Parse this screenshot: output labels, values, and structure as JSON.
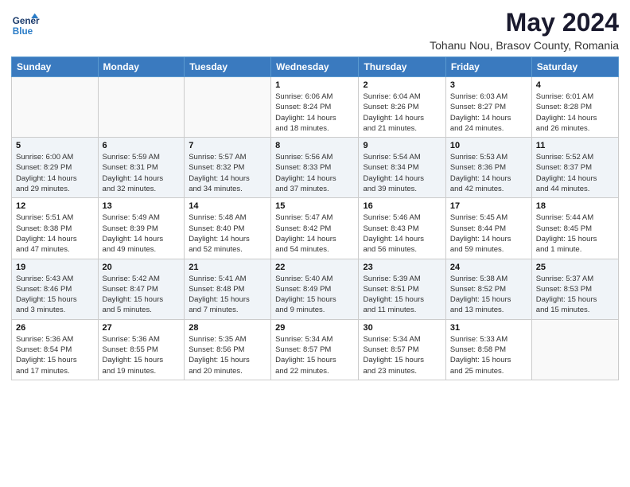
{
  "logo": {
    "line1": "General",
    "line2": "Blue"
  },
  "title": "May 2024",
  "subtitle": "Tohanu Nou, Brasov County, Romania",
  "days_header": [
    "Sunday",
    "Monday",
    "Tuesday",
    "Wednesday",
    "Thursday",
    "Friday",
    "Saturday"
  ],
  "weeks": [
    [
      {
        "day": "",
        "info": ""
      },
      {
        "day": "",
        "info": ""
      },
      {
        "day": "",
        "info": ""
      },
      {
        "day": "1",
        "info": "Sunrise: 6:06 AM\nSunset: 8:24 PM\nDaylight: 14 hours\nand 18 minutes."
      },
      {
        "day": "2",
        "info": "Sunrise: 6:04 AM\nSunset: 8:26 PM\nDaylight: 14 hours\nand 21 minutes."
      },
      {
        "day": "3",
        "info": "Sunrise: 6:03 AM\nSunset: 8:27 PM\nDaylight: 14 hours\nand 24 minutes."
      },
      {
        "day": "4",
        "info": "Sunrise: 6:01 AM\nSunset: 8:28 PM\nDaylight: 14 hours\nand 26 minutes."
      }
    ],
    [
      {
        "day": "5",
        "info": "Sunrise: 6:00 AM\nSunset: 8:29 PM\nDaylight: 14 hours\nand 29 minutes."
      },
      {
        "day": "6",
        "info": "Sunrise: 5:59 AM\nSunset: 8:31 PM\nDaylight: 14 hours\nand 32 minutes."
      },
      {
        "day": "7",
        "info": "Sunrise: 5:57 AM\nSunset: 8:32 PM\nDaylight: 14 hours\nand 34 minutes."
      },
      {
        "day": "8",
        "info": "Sunrise: 5:56 AM\nSunset: 8:33 PM\nDaylight: 14 hours\nand 37 minutes."
      },
      {
        "day": "9",
        "info": "Sunrise: 5:54 AM\nSunset: 8:34 PM\nDaylight: 14 hours\nand 39 minutes."
      },
      {
        "day": "10",
        "info": "Sunrise: 5:53 AM\nSunset: 8:36 PM\nDaylight: 14 hours\nand 42 minutes."
      },
      {
        "day": "11",
        "info": "Sunrise: 5:52 AM\nSunset: 8:37 PM\nDaylight: 14 hours\nand 44 minutes."
      }
    ],
    [
      {
        "day": "12",
        "info": "Sunrise: 5:51 AM\nSunset: 8:38 PM\nDaylight: 14 hours\nand 47 minutes."
      },
      {
        "day": "13",
        "info": "Sunrise: 5:49 AM\nSunset: 8:39 PM\nDaylight: 14 hours\nand 49 minutes."
      },
      {
        "day": "14",
        "info": "Sunrise: 5:48 AM\nSunset: 8:40 PM\nDaylight: 14 hours\nand 52 minutes."
      },
      {
        "day": "15",
        "info": "Sunrise: 5:47 AM\nSunset: 8:42 PM\nDaylight: 14 hours\nand 54 minutes."
      },
      {
        "day": "16",
        "info": "Sunrise: 5:46 AM\nSunset: 8:43 PM\nDaylight: 14 hours\nand 56 minutes."
      },
      {
        "day": "17",
        "info": "Sunrise: 5:45 AM\nSunset: 8:44 PM\nDaylight: 14 hours\nand 59 minutes."
      },
      {
        "day": "18",
        "info": "Sunrise: 5:44 AM\nSunset: 8:45 PM\nDaylight: 15 hours\nand 1 minute."
      }
    ],
    [
      {
        "day": "19",
        "info": "Sunrise: 5:43 AM\nSunset: 8:46 PM\nDaylight: 15 hours\nand 3 minutes."
      },
      {
        "day": "20",
        "info": "Sunrise: 5:42 AM\nSunset: 8:47 PM\nDaylight: 15 hours\nand 5 minutes."
      },
      {
        "day": "21",
        "info": "Sunrise: 5:41 AM\nSunset: 8:48 PM\nDaylight: 15 hours\nand 7 minutes."
      },
      {
        "day": "22",
        "info": "Sunrise: 5:40 AM\nSunset: 8:49 PM\nDaylight: 15 hours\nand 9 minutes."
      },
      {
        "day": "23",
        "info": "Sunrise: 5:39 AM\nSunset: 8:51 PM\nDaylight: 15 hours\nand 11 minutes."
      },
      {
        "day": "24",
        "info": "Sunrise: 5:38 AM\nSunset: 8:52 PM\nDaylight: 15 hours\nand 13 minutes."
      },
      {
        "day": "25",
        "info": "Sunrise: 5:37 AM\nSunset: 8:53 PM\nDaylight: 15 hours\nand 15 minutes."
      }
    ],
    [
      {
        "day": "26",
        "info": "Sunrise: 5:36 AM\nSunset: 8:54 PM\nDaylight: 15 hours\nand 17 minutes."
      },
      {
        "day": "27",
        "info": "Sunrise: 5:36 AM\nSunset: 8:55 PM\nDaylight: 15 hours\nand 19 minutes."
      },
      {
        "day": "28",
        "info": "Sunrise: 5:35 AM\nSunset: 8:56 PM\nDaylight: 15 hours\nand 20 minutes."
      },
      {
        "day": "29",
        "info": "Sunrise: 5:34 AM\nSunset: 8:57 PM\nDaylight: 15 hours\nand 22 minutes."
      },
      {
        "day": "30",
        "info": "Sunrise: 5:34 AM\nSunset: 8:57 PM\nDaylight: 15 hours\nand 23 minutes."
      },
      {
        "day": "31",
        "info": "Sunrise: 5:33 AM\nSunset: 8:58 PM\nDaylight: 15 hours\nand 25 minutes."
      },
      {
        "day": "",
        "info": ""
      }
    ]
  ]
}
